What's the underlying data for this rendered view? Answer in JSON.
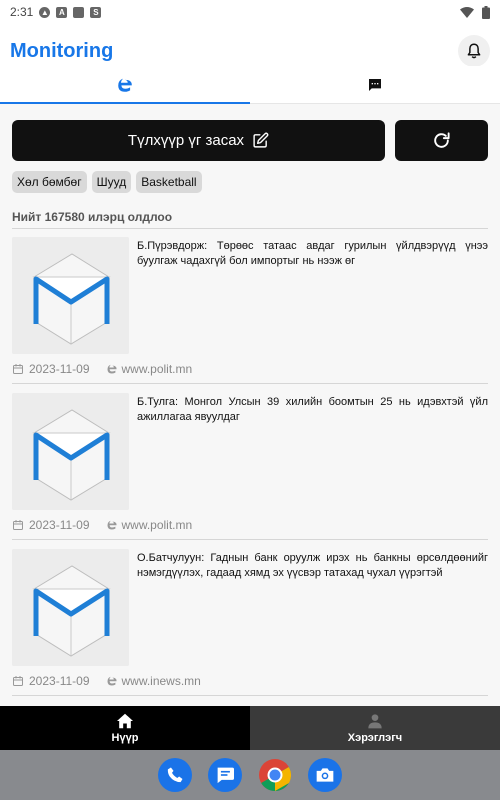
{
  "status_bar": {
    "time": "2:31",
    "notification_icons": [
      "android-auto-icon",
      "a-icon",
      "sd-card-icon",
      "s-icon"
    ],
    "right_icons": [
      "wifi-icon",
      "battery-icon"
    ]
  },
  "app": {
    "title": "Monitoring",
    "accent_color": "#1877e8"
  },
  "tabs": [
    {
      "icon": "edge-browser-icon",
      "active": true
    },
    {
      "icon": "message-icon",
      "active": false
    }
  ],
  "toolbar": {
    "keyword_button_label": "Түлхүүр үг засах",
    "refresh_icon": "refresh-icon"
  },
  "filters": [
    "Хөл бөмбөг",
    "Шууд",
    "Basketball"
  ],
  "result_count_text": "Нийт 167580 илэрц олдлоо",
  "news": [
    {
      "title": "Б.Пүрэвдорж: Төрөөс татаас авдаг гурилын үйлдвэрүүд үнээ буулгаж чадахгүй бол импортыг нь нээж өг",
      "date": "2023-11-09",
      "source": "www.polit.mn"
    },
    {
      "title": "Б.Тулга: Монгол Улсын 39 хилийн боомтын 25 нь идэвхтэй үйл ажиллагаа явуулдаг",
      "date": "2023-11-09",
      "source": "www.polit.mn"
    },
    {
      "title": "О.Батчулуун: Гаднын банк оруулж ирэх нь банкны өрсөлдөөнийг нэмэгдүүлэх, гадаад хямд эх үүсвэр татахад чухал үүрэгтэй",
      "date": "2023-11-09",
      "source": "www.inews.mn"
    }
  ],
  "bottom_nav": [
    {
      "label": "Нүүр",
      "icon": "home-icon",
      "active": true
    },
    {
      "label": "Хэрэглэгч",
      "icon": "user-icon",
      "active": false
    }
  ],
  "dock": [
    "phone-app-icon",
    "messages-app-icon",
    "chrome-app-icon",
    "camera-app-icon"
  ]
}
